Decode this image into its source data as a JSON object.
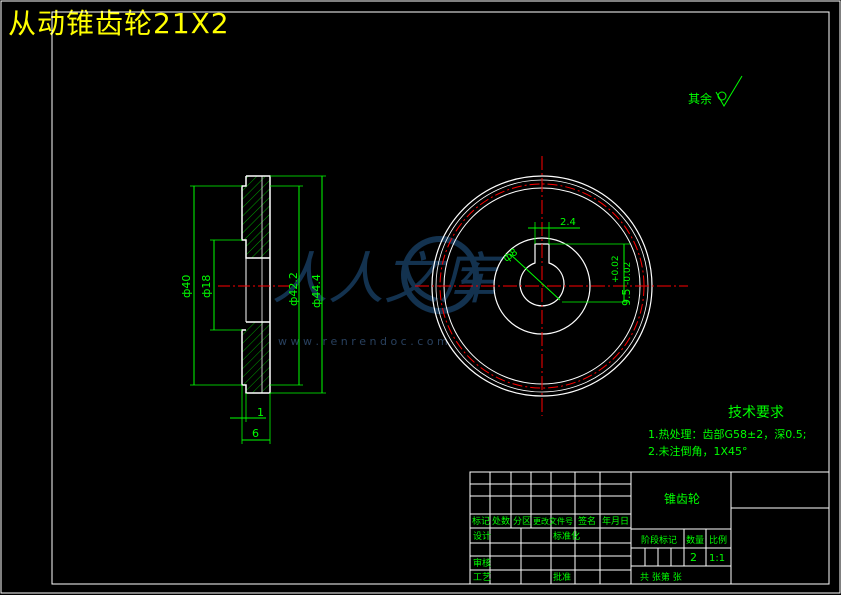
{
  "header": {
    "title": "从动锥齿轮21X2"
  },
  "roughness": {
    "label": "其余"
  },
  "side_view": {
    "dims": {
      "d40": "ф40",
      "d18": "ф18",
      "d42": "ф42.2",
      "d44": "ф44.4",
      "w1": "1",
      "w6": "6"
    }
  },
  "front_view": {
    "dims": {
      "keyway": "2.4",
      "bore": "ф8",
      "tol_top": "+0.02",
      "tol_val": "9.5",
      "tol_bot": "-0.02"
    }
  },
  "watermark": {
    "brand": "人人文库",
    "url": "w w w . r e n r e n d o c . c o m"
  },
  "tech": {
    "heading": "技术要求",
    "line1": "1.热处理：齿部G58±2，深0.5;",
    "line2": "2.未注倒角，1X45°"
  },
  "title_block": {
    "part_name": "锥齿轮",
    "h_mark": "标记",
    "h_count": "处数",
    "h_zone": "分区",
    "h_doc": "更改文件号",
    "h_sign": "签名",
    "h_date": "年月日",
    "design": "设计",
    "standard": "标准化",
    "review": "审核",
    "process": "工艺",
    "approve": "批准",
    "stage": "阶段标记",
    "qty_label": "数量",
    "ratio_label": "比例",
    "qty": "2",
    "ratio": "1:1",
    "sheets": "共  张第  张"
  },
  "colors": {
    "outline": "#ffffff",
    "dim": "#00ff00",
    "center": "#ff0000",
    "title": "#ffff00",
    "hatch": "#00a000"
  }
}
